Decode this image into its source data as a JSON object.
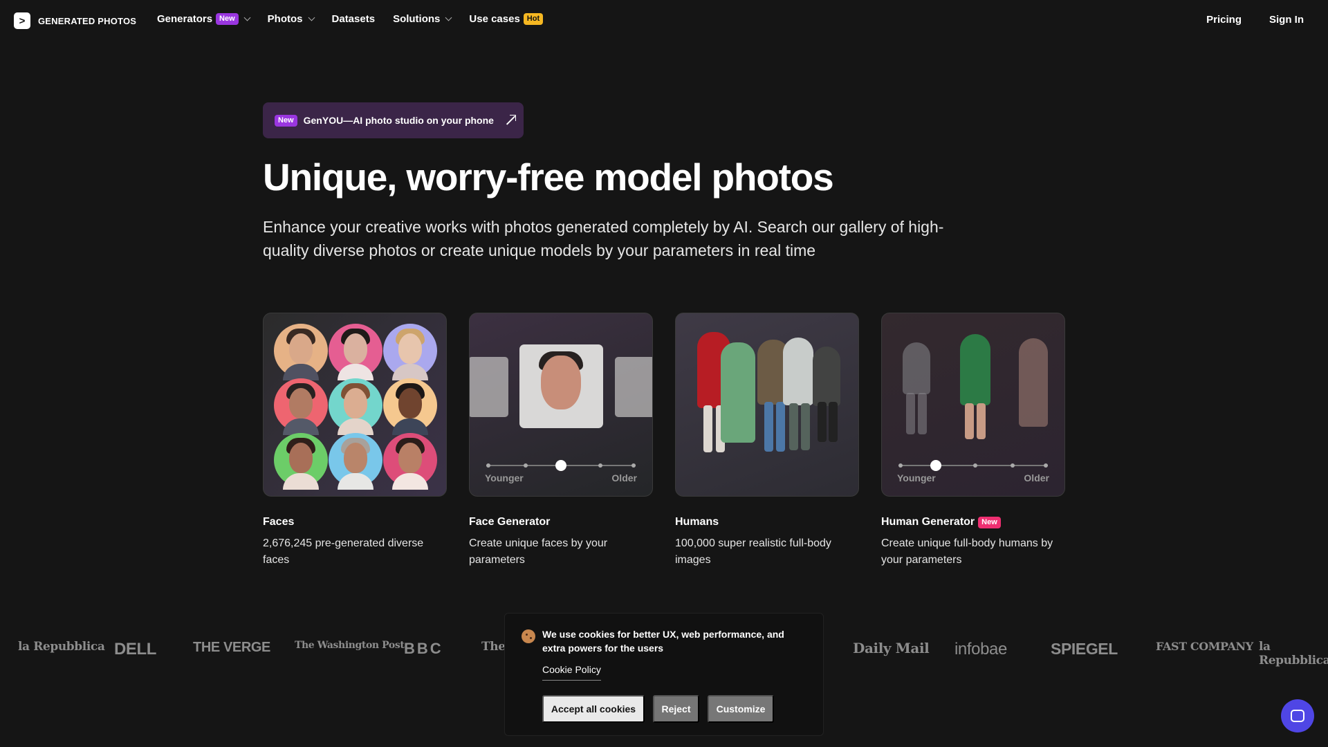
{
  "nav": {
    "logo_text": "GENERATED PHOTOS",
    "items": [
      {
        "label": "Generators",
        "badge": "New",
        "has_dropdown": true
      },
      {
        "label": "Photos",
        "has_dropdown": true
      },
      {
        "label": "Datasets",
        "has_dropdown": false
      },
      {
        "label": "Solutions",
        "has_dropdown": true
      },
      {
        "label": "Use cases",
        "badge": "Hot",
        "has_dropdown": false
      }
    ],
    "pricing": "Pricing",
    "sign_in": "Sign In"
  },
  "hero": {
    "promo_badge": "New",
    "promo_text": "GenYOU—AI photo studio on your phone",
    "title": "Unique, worry-free model photos",
    "subtitle": "Enhance your creative works with photos generated completely by AI. Search our gallery of high-quality diverse photos or create unique models by your parameters in real time"
  },
  "cards": [
    {
      "title": "Faces",
      "description": "2,676,245 pre-generated diverse faces",
      "badge": ""
    },
    {
      "title": "Face Generator",
      "description": "Create unique faces by your parameters",
      "badge": "",
      "slider_min": "Younger",
      "slider_max": "Older",
      "slider_value": 0.5
    },
    {
      "title": "Humans",
      "description": "100,000 super realistic full-body images",
      "badge": ""
    },
    {
      "title": "Human Generator",
      "description": "Create unique full-body humans by your parameters",
      "badge": "New",
      "slider_min": "Younger",
      "slider_max": "Older",
      "slider_value": 0.25
    }
  ],
  "press": [
    "la Repubblica",
    "DELL",
    "THE VERGE",
    "The Washington Post",
    "BBC",
    "The N",
    "Daily Mail",
    "infobae",
    "SPIEGEL",
    "FAST COMPANY",
    "la Repubblica"
  ],
  "cookie": {
    "message": "We use cookies for better UX, web performance, and extra powers for the users",
    "policy_link": "Cookie Policy",
    "accept": "Accept all cookies",
    "reject": "Reject",
    "customize": "Customize"
  },
  "colors": {
    "background": "#151515",
    "accent_purple": "#9a36e0",
    "hot_badge": "#f5b722",
    "new_badge_pink": "#ee2f71",
    "chat_button": "#4f46e5"
  }
}
